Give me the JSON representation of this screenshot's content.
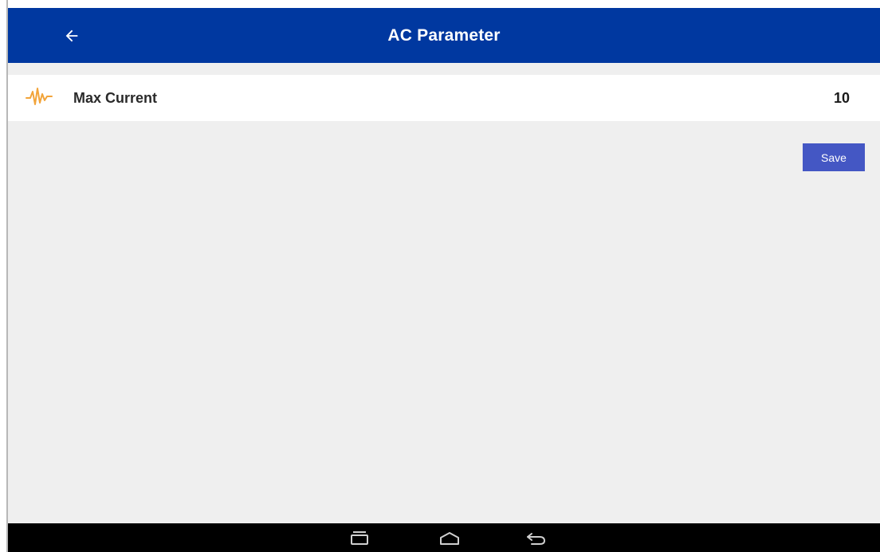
{
  "app_bar": {
    "title": "AC Parameter",
    "back_icon": "arrow-left-icon",
    "color": "#0038a0"
  },
  "parameter": {
    "icon": "waveform-icon",
    "icon_color": "#f2a43a",
    "label": "Max Current",
    "value": "10"
  },
  "actions": {
    "save_label": "Save",
    "save_color": "#4457c4"
  },
  "nav_bar": {
    "buttons": [
      "recent-apps-icon",
      "home-icon",
      "back-icon"
    ]
  }
}
